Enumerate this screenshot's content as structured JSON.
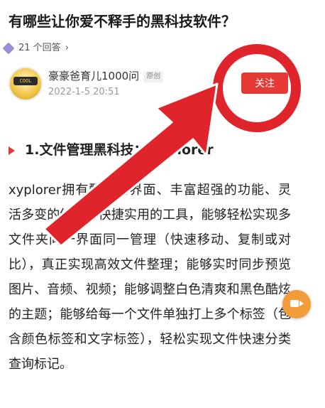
{
  "question": {
    "title": "有哪些让你爱不释手的黑科技软件？",
    "answers_count": "21 个回答",
    "chevron": "›"
  },
  "author": {
    "name": "豪豪爸育儿1000问",
    "tag": "原创",
    "date": "2022-1-5 20:51",
    "avatar_text": "COOL"
  },
  "follow_button": {
    "label": "关注"
  },
  "section": {
    "heading": "1.文件管理黑科技：XYplorer"
  },
  "article": {
    "body": "xyplorer拥有酷炫的界面、丰富超强的功能、灵活多变的结构、快捷实用的工具，能够轻松实现多文件夹同一界面同一管理（快速移动、复制或对比），真正实现高效文件整理；能够实时同步预览图片、音频、视频；能够调整白色清爽和黑色酷炫的主题；能够给每一个文件单独打上多个标签（包含颜色标签和文字标签），轻松实现文件快速分类查询标记。"
  },
  "icons": {
    "float_button": "video-camera-icon",
    "annotation": "red-arrow-pointing-to-follow"
  },
  "colors": {
    "accent_red": "#e53935",
    "annotation_red": "#e0242b",
    "float_orange": "#f39c3a"
  }
}
